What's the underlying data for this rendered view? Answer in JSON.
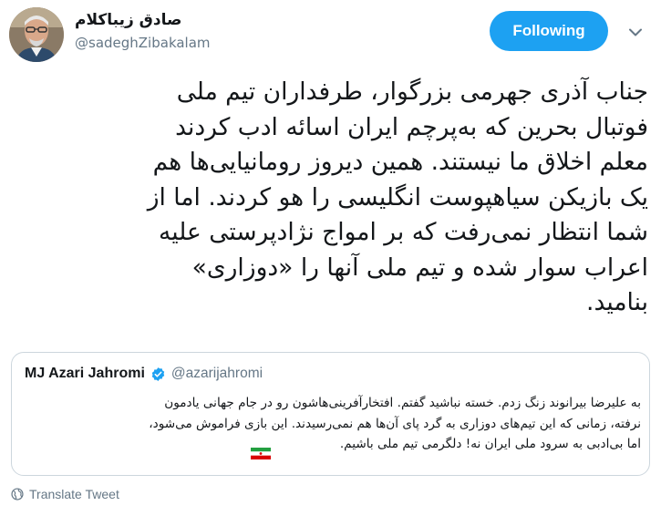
{
  "author": {
    "display_name": "صادق زیباکلام",
    "handle": "@sadeghZibakalam",
    "avatar_icon": "profile-photo"
  },
  "follow_button": {
    "label": "Following",
    "color": "#1da1f2"
  },
  "caret_icon": "chevron-down-icon",
  "tweet_text": "جناب آذری جهرمی بزرگوار،  طرفداران تیم ملی\nفوتبال بحرین که به‌پرچم ایران اسائه ادب کردند\nمعلم اخلاق ما نیستند. همین دیروز رومانیایی‌ها هم\nیک بازیکن سیاهپوست انگلیسی را هو کردند. اما از\nشما انتظار نمی‌رفت که بر امواج نژادپرستی علیه\nاعراب سوار شده و تیم ملی آنها را «دوزاری»\nبنامید.",
  "quoted_tweet": {
    "name": "MJ Azari Jahromi",
    "handle": "@azarijahromi",
    "verified": true,
    "text": "به علیرضا بیرانوند زنگ زدم. خسته نباشید گفتم. افتخارآفرینی‌هاشون رو در جام جهانی یادمون\nنرفته، زمانی که این تیم‌های دوزاری به گرد پای آن‌ها هم نمی‌رسیدند. این بازی فراموش می‌شود،\nاما بی‌ادبی به سرود ملی ایران نه! دلگرمی تیم ملی باشیم.",
    "emoji": "iran-flag"
  },
  "translate": {
    "label": "Translate Tweet",
    "icon": "globe-icon"
  },
  "colors": {
    "accent": "#1da1f2",
    "text": "#14171a",
    "secondary": "#657786",
    "border": "#ccd6dd"
  }
}
